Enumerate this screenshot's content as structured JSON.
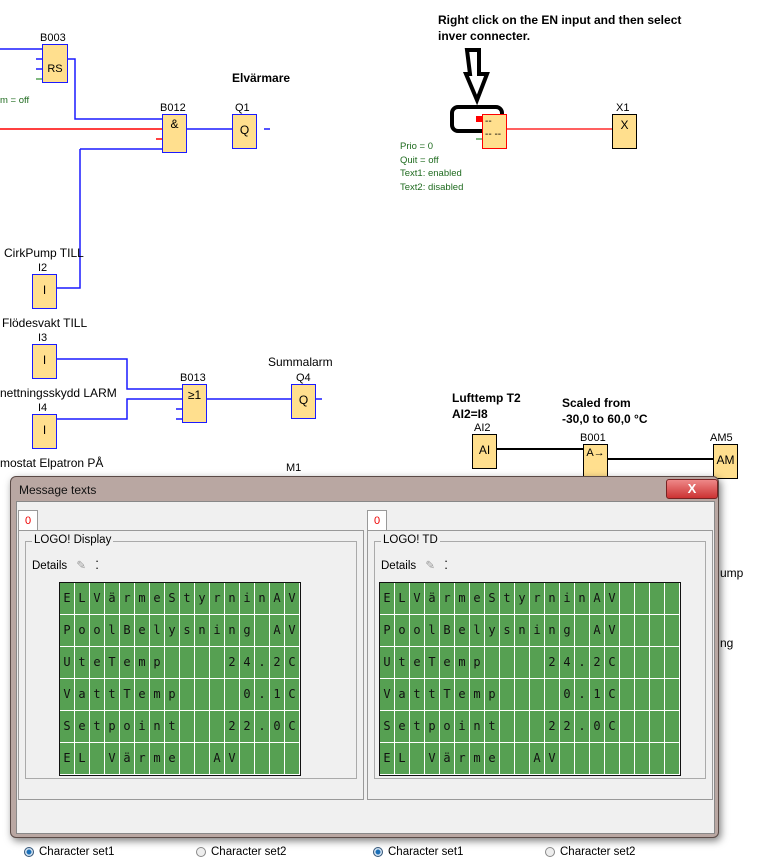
{
  "diagram": {
    "b003": "B003",
    "b003_sym": "RS",
    "partial_param": "m = off",
    "elvarmare": "Elvärmare",
    "b012": "B012",
    "b012_sym": "&",
    "q1": "Q1",
    "q1_sym": "Q",
    "instruction_line1": "Right click on the EN input and then select",
    "instruction_line2": "inver connecter.",
    "b0x_sym1": "--",
    "b0x_sym2": "-- --",
    "x1": "X1",
    "x1_sym": "X",
    "params": [
      "Prio = 0",
      "Quit = off",
      "Text1: enabled",
      "Text2: disabled"
    ],
    "cirkpump": "CirkPump TILL",
    "i2": "I2",
    "i_sym": "I",
    "flodesvakt": "Flödesvakt TILL",
    "i3": "I3",
    "frysskydd": "nettningsskydd LARM",
    "i4": "I4",
    "termostat": "mostat Elpatron PÅ",
    "m1": "M1",
    "b013": "B013",
    "b013_sym": "≥1",
    "summalarm": "Summalarm",
    "q4": "Q4",
    "q4_sym": "Q",
    "lufttemp1": "Lufttemp T2",
    "lufttemp2": "AI2=I8",
    "ai2": "AI2",
    "ai_sym": "AI",
    "scaled1": "Scaled from",
    "scaled2": "-30,0 to 60,0 °C",
    "b001": "B001",
    "b001_sym": "A→",
    "am5": "AM5",
    "am_sym": "AM",
    "right_partial1": "ump",
    "right_partial2": "ng"
  },
  "dialog": {
    "title": "Message texts",
    "close_label": "X",
    "panes": [
      {
        "tab": "0",
        "group": "LOGO! Display",
        "details": "Details",
        "columns": 16,
        "rows": [
          "ELVärmeStyrninAV",
          "PoolBelysning AV",
          "UteTemp    24.2C",
          "VattTemp    0.1C",
          "Setpoint   22.0C",
          "EL Värme  AV    "
        ],
        "radio1": "Character set1",
        "radio2": "Character set2",
        "selected": "Character set1"
      },
      {
        "tab": "0",
        "group": "LOGO! TD",
        "details": "Details",
        "columns": 20,
        "rows": [
          "ELVärmeStyrninAV    ",
          "PoolBelysning AV    ",
          "UteTemp    24.2C    ",
          "VattTemp    0.1C    ",
          "Setpoint   22.0C    ",
          "EL Värme  AV        "
        ],
        "radio1": "Character set1",
        "radio2": "Character set2",
        "selected": "Character set1"
      }
    ]
  },
  "colors": {
    "block_fill": "#ffdf8e",
    "wire_blue": "#1a1aff",
    "wire_red": "#ff0000",
    "lcd_green": "#56a052"
  }
}
